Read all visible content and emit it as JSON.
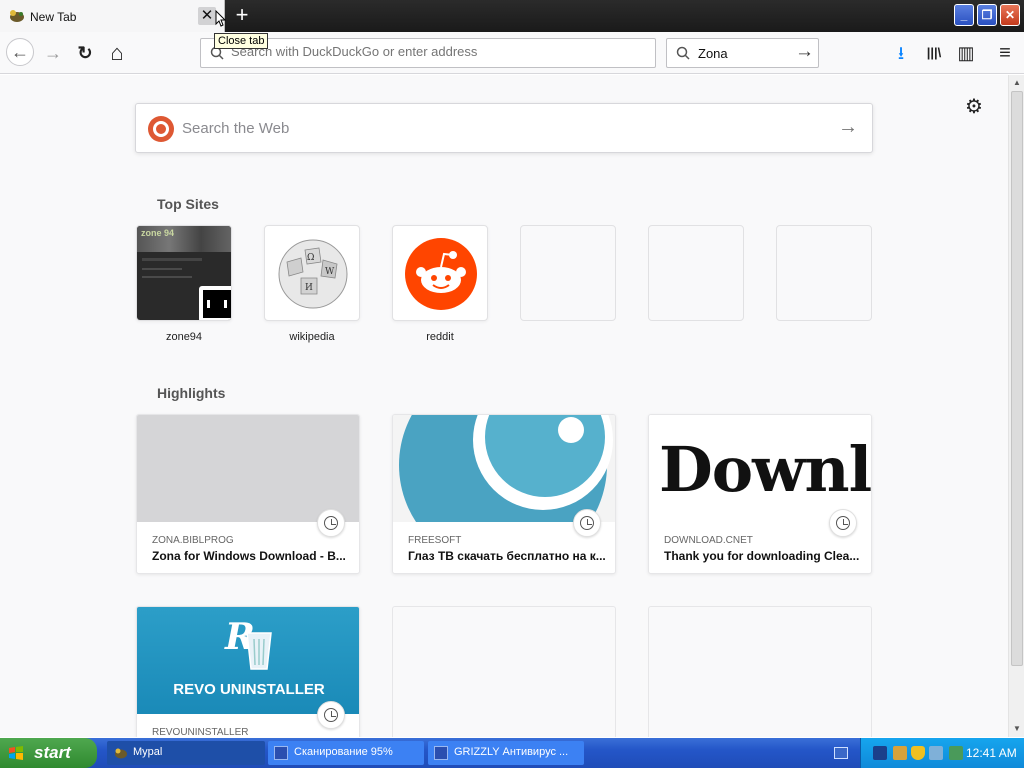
{
  "tab": {
    "title": "New Tab",
    "close_symbol": "✕",
    "tooltip": "Close tab"
  },
  "new_tab_symbol": "+",
  "window_controls": {
    "minimize": "_",
    "restore": "❐",
    "close": "✕"
  },
  "nav": {
    "back_symbol": "←",
    "forward_symbol": "→",
    "reload_symbol": "↻",
    "home_symbol": "⌂",
    "url_placeholder": "Search with DuckDuckGo or enter address",
    "search_value": "Zona",
    "search_go_symbol": "→",
    "downloads_symbol": "⭳",
    "library_symbol": "|||\\",
    "sidebar_symbol": "▥",
    "menu_symbol": "≡"
  },
  "page": {
    "settings_symbol": "⚙",
    "web_search_placeholder": "Search the Web",
    "web_search_go": "→",
    "top_sites_title": "Top Sites",
    "top_sites": [
      {
        "label": "zone94"
      },
      {
        "label": "wikipedia"
      },
      {
        "label": "reddit"
      },
      {
        "label": ""
      },
      {
        "label": ""
      },
      {
        "label": ""
      }
    ],
    "highlights_title": "Highlights",
    "highlights": [
      {
        "host": "ZONA.BIBLPROG",
        "title": "Zona for Windows Download - B..."
      },
      {
        "host": "FREESOFT",
        "title": "Глаз ТВ скачать бесплатно на к..."
      },
      {
        "host": "DOWNLOAD.CNET",
        "title": "Thank you for downloading Clea...",
        "thumb_text": "Downl"
      },
      {
        "host": "REVOUNINSTALLER",
        "title": "",
        "thumb_text": "REVO UNINSTALLER"
      }
    ],
    "zone94_logo": "zone 94"
  },
  "taskbar": {
    "start_label": "start",
    "tasks": [
      {
        "label": "Mypal"
      },
      {
        "label": "Сканирование 95%"
      },
      {
        "label": "GRIZZLY Антивирус ..."
      }
    ],
    "clock": "12:41 AM"
  },
  "colors": {
    "ddg": "#de5833",
    "reddit": "#ff4500",
    "taskbar": "#2456c8",
    "start": "#3c9a3c",
    "accent_download": "#0a84ff"
  }
}
